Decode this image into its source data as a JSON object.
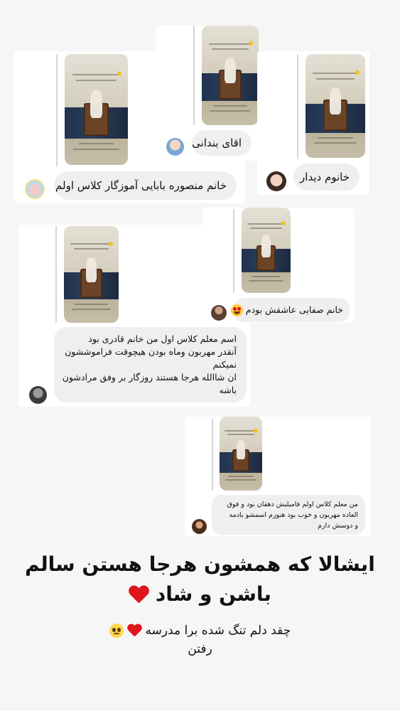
{
  "replies": [
    {
      "text": "خانم منصوره بابایی آموزگار کلاس اولم",
      "avatar_icon": "cartoon-girl-avatar"
    },
    {
      "text": "اقای بندانی",
      "avatar_icon": "child-avatar"
    },
    {
      "text": "خانوم دیدار",
      "avatar_icon": "woman-avatar"
    },
    {
      "text": "خانم صفایی عاشقش بودم",
      "emoji": "heart-eyes-emoji",
      "avatar_icon": "man-avatar"
    },
    {
      "lines": [
        "اسم معلم کلاس اول من خانم قادری بود",
        "آنقدر مهربون وماه بودن هیچوقت فراموششون",
        "نمیکنم",
        "ان شاالله هرجا هستند روزگار بر وفق مرادشون",
        "باشه"
      ],
      "avatar_icon": "person-avatar"
    },
    {
      "lines": [
        "من معلم کلاس اولم فامیلیش دهقان بود و فوق",
        "العاده مهربون و خوب بود هنوزم اسمشو یادمه",
        "و دوسش دارم"
      ],
      "avatar_icon": "couple-avatar"
    }
  ],
  "caption": {
    "line1": "ایشالا که همشون هرجا هستن سالم",
    "line2": "باشن و شاد",
    "line2_emoji": "red-heart-emoji"
  },
  "sub_caption": {
    "line1": "چقد دلم تنگ شده برا مدرسه",
    "line2": "رفتن",
    "emoji": [
      "red-heart-emoji",
      "pleading-face-emoji"
    ]
  },
  "colors": {
    "background": "#f6f6f7",
    "bubble": "#efeff1",
    "heart": "#e0151b"
  }
}
